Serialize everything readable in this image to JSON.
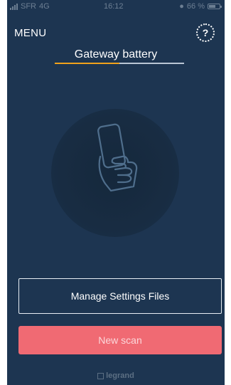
{
  "status_bar": {
    "carrier": "SFR",
    "network": "4G",
    "time": "16:12",
    "battery_text": "66 %",
    "battery_level": 0.66
  },
  "header": {
    "menu_label": "MENU",
    "help_label": "?"
  },
  "title": {
    "text": "Gateway battery",
    "progress": 0.5
  },
  "buttons": {
    "manage_settings": "Manage Settings Files",
    "new_scan": "New scan"
  },
  "brand": {
    "name": "legrand"
  },
  "icons": {
    "scan_illustration": "phone-in-hand-icon",
    "help": "help-icon",
    "alarm": "alarm-icon",
    "brand": "legrand-logo-icon"
  },
  "colors": {
    "background": "#1d3551",
    "accent_underline": "#f0a21c",
    "primary_button": "#f06a73"
  }
}
